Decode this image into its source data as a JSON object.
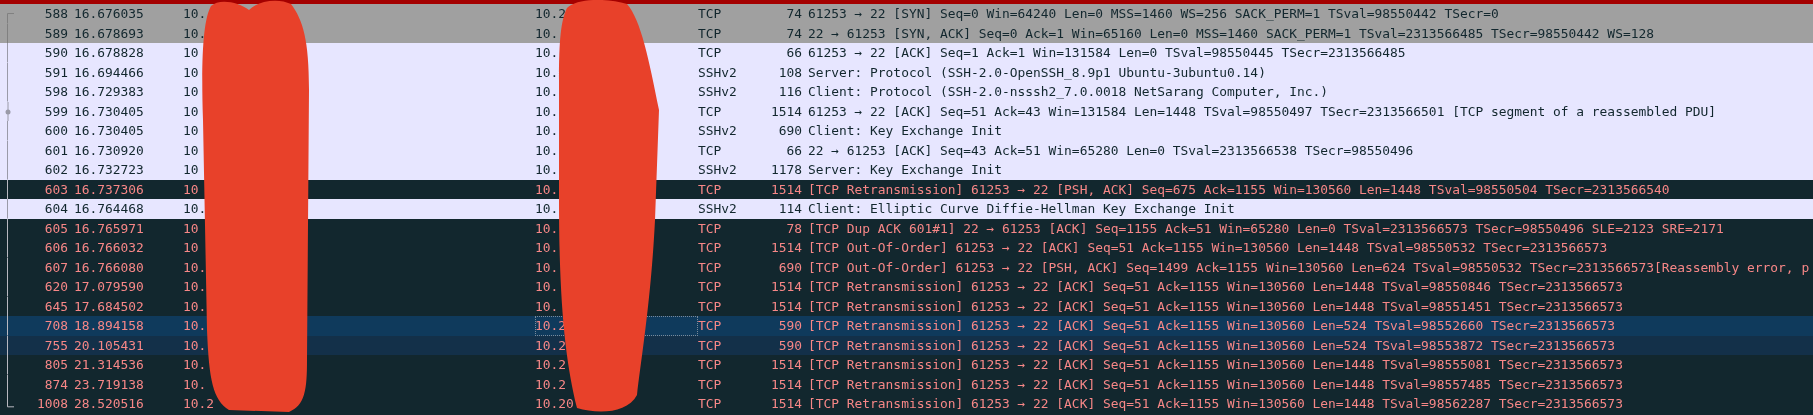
{
  "packets": [
    {
      "no": "588",
      "time": "16.676035",
      "source": "10.",
      "destination": "10.2",
      "protocol": "TCP",
      "length": "74",
      "info": "61253 → 22 [SYN] Seq=0 Win=64240 Len=0 MSS=1460 WS=256 SACK_PERM=1 TSval=98550442 TSecr=0",
      "kind": "syn",
      "selected": false,
      "hovered": false,
      "related_dot": false
    },
    {
      "no": "589",
      "time": "16.678693",
      "source": "10.",
      "destination": "10.",
      "protocol": "TCP",
      "length": "74",
      "info": "22 → 61253 [SYN, ACK] Seq=0 Ack=1 Win=65160 Len=0 MSS=1460 SACK_PERM=1 TSval=2313566485 TSecr=98550442 WS=128",
      "kind": "syn",
      "selected": false,
      "hovered": false,
      "related_dot": false
    },
    {
      "no": "590",
      "time": "16.678828",
      "source": "10",
      "destination": "10.",
      "protocol": "TCP",
      "length": "66",
      "info": "61253 → 22 [ACK] Seq=1 Ack=1 Win=131584 Len=0 TSval=98550445 TSecr=2313566485",
      "kind": "normal",
      "selected": false,
      "hovered": false,
      "related_dot": false
    },
    {
      "no": "591",
      "time": "16.694466",
      "source": "10",
      "destination": "10.",
      "protocol": "SSHv2",
      "length": "108",
      "info": "Server: Protocol (SSH-2.0-OpenSSH_8.9p1 Ubuntu-3ubuntu0.14)",
      "kind": "normal",
      "selected": false,
      "hovered": false,
      "related_dot": false
    },
    {
      "no": "598",
      "time": "16.729383",
      "source": "10",
      "destination": "10.",
      "protocol": "SSHv2",
      "length": "116",
      "info": "Client: Protocol (SSH-2.0-nsssh2_7.0.0018 NetSarang Computer, Inc.)",
      "kind": "normal",
      "selected": false,
      "hovered": false,
      "related_dot": false
    },
    {
      "no": "599",
      "time": "16.730405",
      "source": "10",
      "destination": "10.",
      "protocol": "TCP",
      "length": "1514",
      "info": "61253 → 22 [ACK] Seq=51 Ack=43 Win=131584 Len=1448 TSval=98550497 TSecr=2313566501 [TCP segment of a reassembled PDU]",
      "kind": "normal",
      "selected": false,
      "hovered": false,
      "related_dot": true
    },
    {
      "no": "600",
      "time": "16.730405",
      "source": "10",
      "destination": "10.",
      "protocol": "SSHv2",
      "length": "690",
      "info": "Client: Key Exchange Init",
      "kind": "normal",
      "selected": false,
      "hovered": false,
      "related_dot": false
    },
    {
      "no": "601",
      "time": "16.730920",
      "source": "10",
      "destination": "10.",
      "protocol": "TCP",
      "length": "66",
      "info": "22 → 61253 [ACK] Seq=43 Ack=51 Win=65280 Len=0 TSval=2313566538 TSecr=98550496",
      "kind": "normal",
      "selected": false,
      "hovered": false,
      "related_dot": false
    },
    {
      "no": "602",
      "time": "16.732723",
      "source": "10",
      "destination": "10.",
      "protocol": "SSHv2",
      "length": "1178",
      "info": "Server: Key Exchange Init",
      "kind": "normal",
      "selected": false,
      "hovered": false,
      "related_dot": false
    },
    {
      "no": "603",
      "time": "16.737306",
      "source": "10",
      "destination": "10.",
      "protocol": "TCP",
      "length": "1514",
      "info": "[TCP Retransmission] 61253 → 22 [PSH, ACK] Seq=675 Ack=1155 Win=130560 Len=1448 TSval=98550504 TSecr=2313566540",
      "kind": "bad",
      "selected": false,
      "hovered": false,
      "related_dot": false
    },
    {
      "no": "604",
      "time": "16.764468",
      "source": "10.",
      "destination": "10.",
      "protocol": "SSHv2",
      "length": "114",
      "info": "Client: Elliptic Curve Diffie-Hellman Key Exchange Init",
      "kind": "normal",
      "selected": false,
      "hovered": false,
      "related_dot": false
    },
    {
      "no": "605",
      "time": "16.765971",
      "source": "10",
      "destination": "10.",
      "protocol": "TCP",
      "length": "78",
      "info": "[TCP Dup ACK 601#1] 22 → 61253 [ACK] Seq=1155 Ack=51 Win=65280 Len=0 TSval=2313566573 TSecr=98550496 SLE=2123 SRE=2171",
      "kind": "bad",
      "selected": false,
      "hovered": false,
      "related_dot": false
    },
    {
      "no": "606",
      "time": "16.766032",
      "source": "10",
      "destination": "10.",
      "protocol": "TCP",
      "length": "1514",
      "info": "[TCP Out-Of-Order] 61253 → 22 [ACK] Seq=51 Ack=1155 Win=130560 Len=1448 TSval=98550532 TSecr=2313566573",
      "kind": "bad",
      "selected": false,
      "hovered": false,
      "related_dot": false
    },
    {
      "no": "607",
      "time": "16.766080",
      "source": "10.",
      "destination": "10.",
      "protocol": "TCP",
      "length": "690",
      "info": "[TCP Out-Of-Order] 61253 → 22 [PSH, ACK] Seq=1499 Ack=1155 Win=130560 Len=624 TSval=98550532 TSecr=2313566573[Reassembly error, p",
      "kind": "bad",
      "selected": false,
      "hovered": false,
      "related_dot": false
    },
    {
      "no": "620",
      "time": "17.079590",
      "source": "10.",
      "destination": "10.",
      "protocol": "TCP",
      "length": "1514",
      "info": "[TCP Retransmission] 61253 → 22 [ACK] Seq=51 Ack=1155 Win=130560 Len=1448 TSval=98550846 TSecr=2313566573",
      "kind": "bad",
      "selected": false,
      "hovered": false,
      "related_dot": false
    },
    {
      "no": "645",
      "time": "17.684502",
      "source": "10.",
      "destination": "10.",
      "protocol": "TCP",
      "length": "1514",
      "info": "[TCP Retransmission] 61253 → 22 [ACK] Seq=51 Ack=1155 Win=130560 Len=1448 TSval=98551451 TSecr=2313566573",
      "kind": "bad",
      "selected": false,
      "hovered": false,
      "related_dot": false
    },
    {
      "no": "708",
      "time": "18.894158",
      "source": "10.",
      "destination": "10.2",
      "protocol": "TCP",
      "length": "590",
      "info": "[TCP Retransmission] 61253 → 22 [ACK] Seq=51 Ack=1155 Win=130560 Len=524 TSval=98552660 TSecr=2313566573",
      "kind": "bad",
      "selected": true,
      "hovered": false,
      "related_dot": false
    },
    {
      "no": "755",
      "time": "20.105431",
      "source": "10.",
      "destination": "10.2",
      "protocol": "TCP",
      "length": "590",
      "info": "[TCP Retransmission] 61253 → 22 [ACK] Seq=51 Ack=1155 Win=130560 Len=524 TSval=98553872 TSecr=2313566573",
      "kind": "bad",
      "selected": false,
      "hovered": true,
      "related_dot": false
    },
    {
      "no": "805",
      "time": "21.314536",
      "source": "10.",
      "destination": "10.2",
      "protocol": "TCP",
      "length": "1514",
      "info": "[TCP Retransmission] 61253 → 22 [ACK] Seq=51 Ack=1155 Win=130560 Len=1448 TSval=98555081 TSecr=2313566573",
      "kind": "bad",
      "selected": false,
      "hovered": false,
      "related_dot": false
    },
    {
      "no": "874",
      "time": "23.719138",
      "source": "10.",
      "destination": "10.2",
      "protocol": "TCP",
      "length": "1514",
      "info": "[TCP Retransmission] 61253 → 22 [ACK] Seq=51 Ack=1155 Win=130560 Len=1448 TSval=98557485 TSecr=2313566573",
      "kind": "bad",
      "selected": false,
      "hovered": false,
      "related_dot": false
    },
    {
      "no": "1008",
      "time": "28.520516",
      "source": "10.2",
      "destination": "10.20",
      "protocol": "TCP",
      "length": "1514",
      "info": "[TCP Retransmission] 61253 → 22 [ACK] Seq=51 Ack=1155 Win=130560 Len=1448 TSval=98562287 TSecr=2313566573",
      "kind": "bad",
      "selected": false,
      "hovered": false,
      "related_dot": false
    }
  ]
}
